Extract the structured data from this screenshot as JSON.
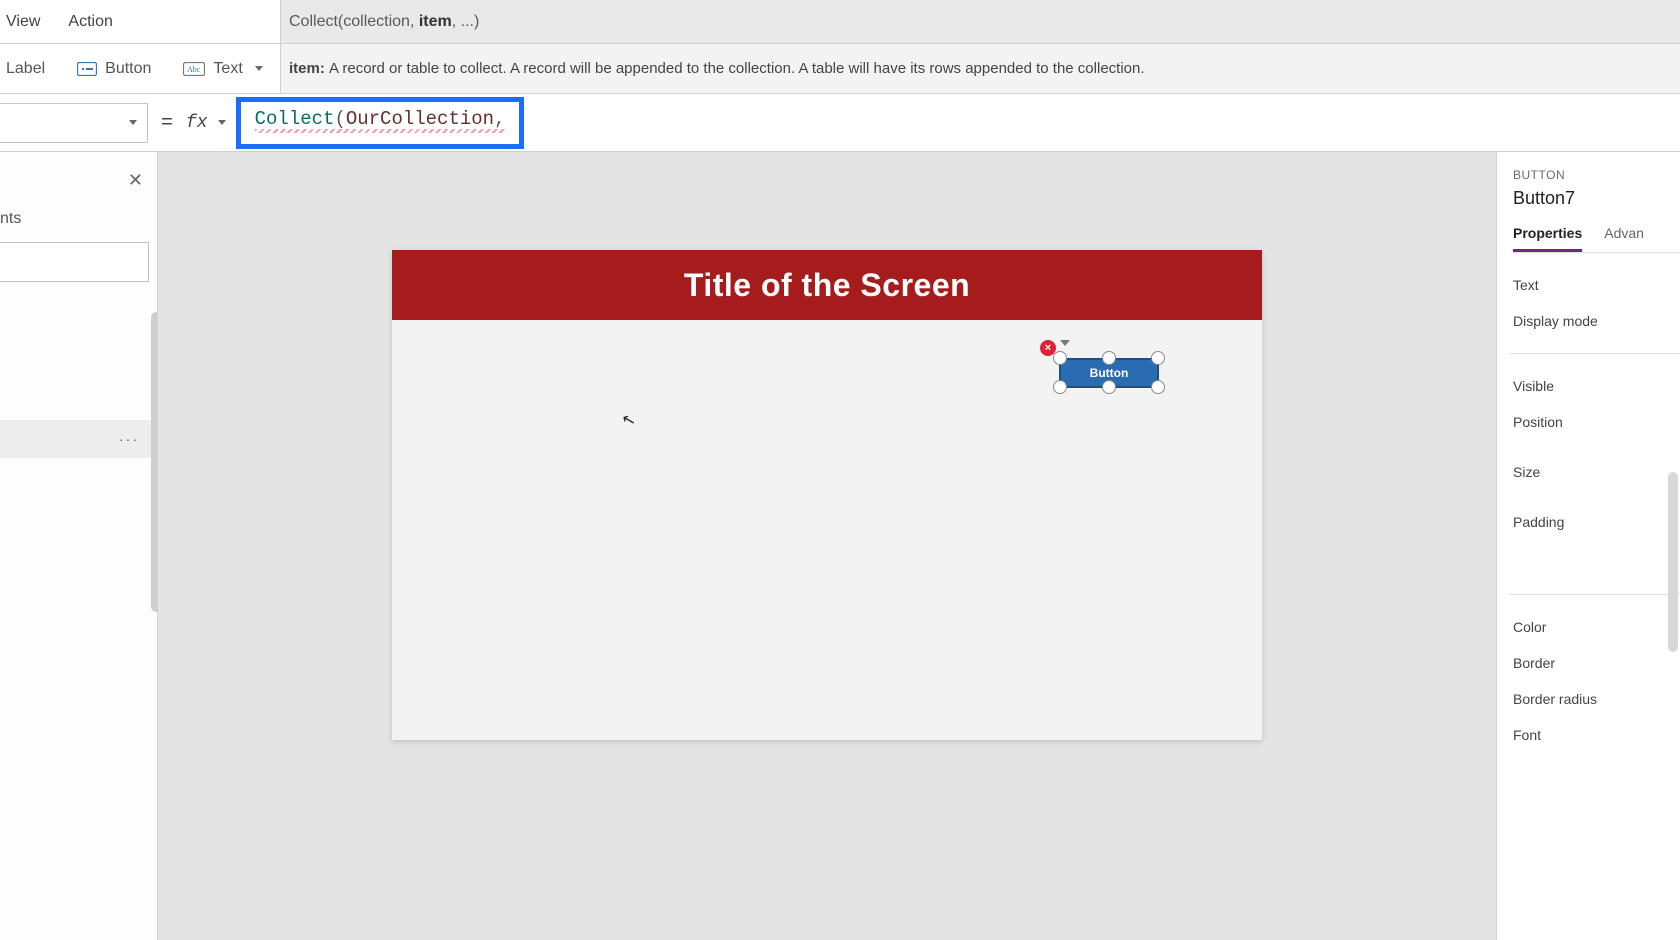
{
  "menu": {
    "view": "View",
    "action": "Action"
  },
  "intellisense": {
    "fn": "Collect",
    "args_pre": "(collection, ",
    "current_arg": "item",
    "args_post": ", ...)"
  },
  "ribbon": {
    "label": "Label",
    "button": "Button",
    "text": "Text",
    "hint_param": "item:",
    "hint_text": "A record or table to collect. A record will be appended to the collection. A table will have its rows appended to the collection."
  },
  "formula": {
    "equals": "=",
    "fx": "fx",
    "fn": "Collect",
    "lpar": "(",
    "collection_id": "OurCollection",
    "comma": ","
  },
  "tree": {
    "header_suffix": "nts",
    "selected_more": "···"
  },
  "canvas": {
    "screen_title": "Title of the Screen",
    "button_text": "Button",
    "error_glyph": "×"
  },
  "right": {
    "type_label": "BUTTON",
    "name": "Button7",
    "tab_props": "Properties",
    "tab_adv": "Advan",
    "props": {
      "text": "Text",
      "display_mode": "Display mode",
      "visible": "Visible",
      "position": "Position",
      "size": "Size",
      "padding": "Padding",
      "color": "Color",
      "border": "Border",
      "border_radius": "Border radius",
      "font": "Font"
    }
  }
}
